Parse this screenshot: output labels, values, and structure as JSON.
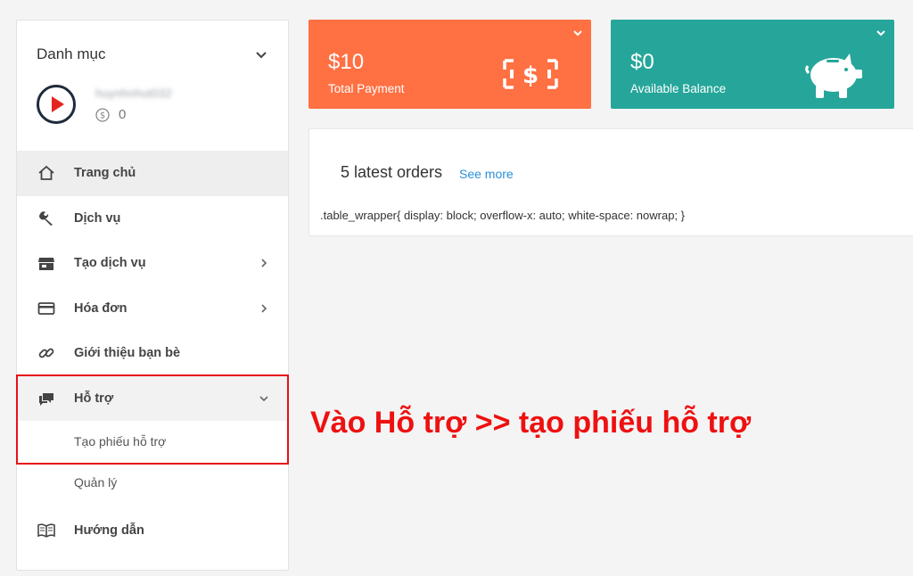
{
  "sidebar": {
    "header_title": "Danh mục",
    "username": "huynhnhut032",
    "balance": "0",
    "menu": [
      {
        "label": "Trang chủ"
      },
      {
        "label": "Dịch vụ"
      },
      {
        "label": "Tạo dịch vụ"
      },
      {
        "label": "Hóa đơn"
      },
      {
        "label": "Giới thiệu bạn bè"
      },
      {
        "label": "Hỗ trợ"
      },
      {
        "label": "Hướng dẫn"
      }
    ],
    "support_sub": [
      {
        "label": "Tạo phiếu hỗ trợ"
      },
      {
        "label": "Quản lý"
      }
    ]
  },
  "cards": {
    "payment": {
      "amount": "$10",
      "label": "Total Payment",
      "color": "#ff7043"
    },
    "balance": {
      "amount": "$0",
      "label": "Available Balance",
      "color": "#26a69a"
    }
  },
  "orders": {
    "title": "5 latest orders",
    "see_more": "See more",
    "raw_css_text": ".table_wrapper{ display: block; overflow-x: auto; white-space: nowrap; }"
  },
  "annotation": {
    "text": "Vào Hỗ trợ >> tạo phiếu hỗ trợ",
    "color": "#ee1111"
  },
  "icons": [
    "chevron-down-icon",
    "avatar-play-icon",
    "coin-icon",
    "home-icon",
    "wrench-icon",
    "store-icon",
    "card-icon",
    "link-icon",
    "forum-icon",
    "book-icon",
    "chevron-right-icon",
    "money-bill-icon",
    "piggy-bank-icon"
  ]
}
